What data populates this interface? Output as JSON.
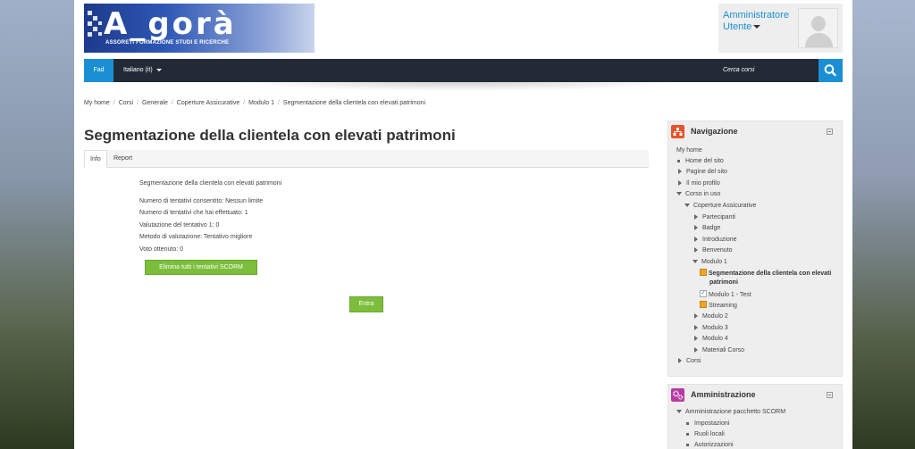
{
  "header": {
    "logo_text": "A_gorà",
    "logo_sub": "ASSORETI FORMAZIONE STUDI E RICERCHE",
    "user_name": "Amministratore Utente"
  },
  "navbar": {
    "fad": "Fad",
    "language": "Italiano (it)",
    "search_placeholder": "Cerca corsi"
  },
  "breadcrumb": [
    "My home",
    "Corsi",
    "Generale",
    "Coperture Assicurative",
    "Modulo 1",
    "Segmentazione della clientela con elevati patrimoni"
  ],
  "main": {
    "title": "Segmentazione della clientela con elevati patrimoni",
    "tabs": [
      "Info",
      "Report"
    ],
    "description": "Segmentazione della clientela con elevati patrimoni",
    "details": [
      "Numero di tentativi consentito: Nessun limite",
      "Numero di tentativi che hai effettuato: 1",
      "Valutazione del tentativo 1: 0",
      "Metodo di valutazione: Tentativo migliore",
      "Voto ottenuto: 0"
    ],
    "delete_button": "Elimina tutti i tentativi SCORM",
    "enter_button": "Entra"
  },
  "navigation": {
    "title": "Navigazione",
    "items": [
      "My home",
      "Home del sito",
      "Pagine del sito",
      "Il mio profilo",
      "Corso in uso",
      "Coperture Assicurative",
      "Partecipanti",
      "Badge",
      "Introduzione",
      "Benvenuto",
      "Modulo 1",
      "Segmentazione della clientela con elevati",
      "patrimoni",
      "Modulo 1 - Test",
      "Streaming",
      "Modulo 2",
      "Modulo 3",
      "Modulo 4",
      "Materiali Corso",
      "Corsi"
    ]
  },
  "administration": {
    "title": "Amministrazione",
    "items": [
      "Amministrazione pacchetto SCORM",
      "Impostazioni",
      "Ruoli locali",
      "Autorizzazioni"
    ]
  },
  "colors": {
    "accent": "#1a8fd4",
    "navbar": "#222a36",
    "button_green": "#7cbe3c",
    "nav_icon": "#e8542a",
    "admin_icon": "#b83aa3"
  },
  "icons": {
    "search": "search-icon",
    "navigation": "sitemap-icon",
    "administration": "cogs-icon",
    "scorm": "scorm-icon",
    "quiz": "quiz-icon"
  }
}
